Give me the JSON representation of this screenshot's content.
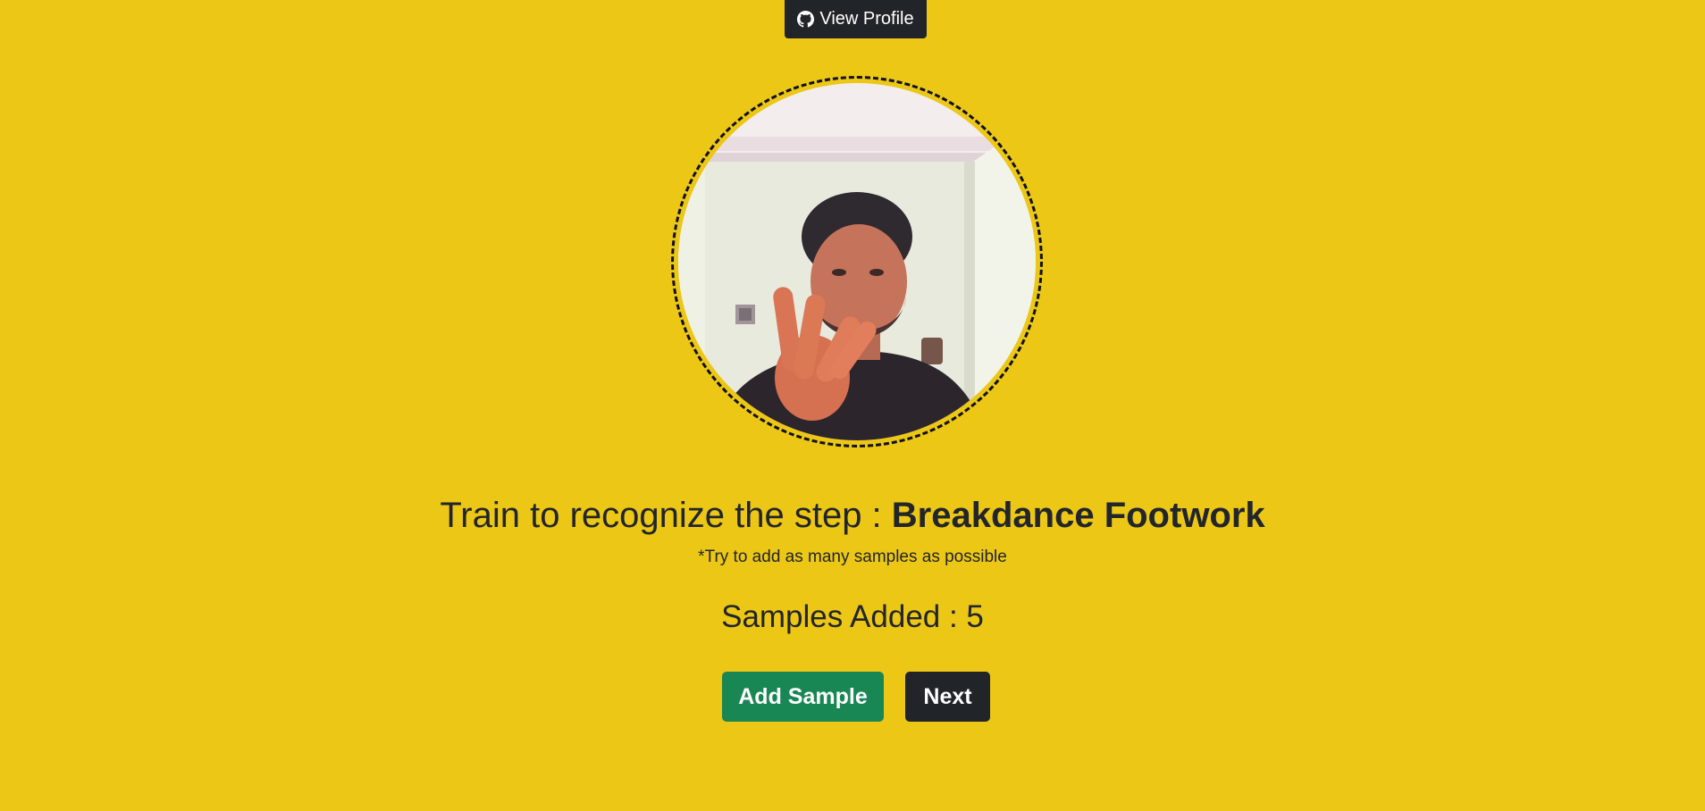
{
  "header": {
    "profile_label": "View Profile",
    "profile_icon": "github-icon"
  },
  "webcam": {
    "feed_icon": "webcam-feed"
  },
  "training": {
    "prompt_prefix": "Train to recognize the step : ",
    "step_name": "Breakdance Footwork",
    "hint": "*Try to add as many samples as possible",
    "samples_label": "Samples Added : 5"
  },
  "actions": {
    "add_sample_label": "Add Sample",
    "next_label": "Next"
  },
  "colors": {
    "background": "#ecc716",
    "dark": "#212529",
    "success": "#198754"
  }
}
